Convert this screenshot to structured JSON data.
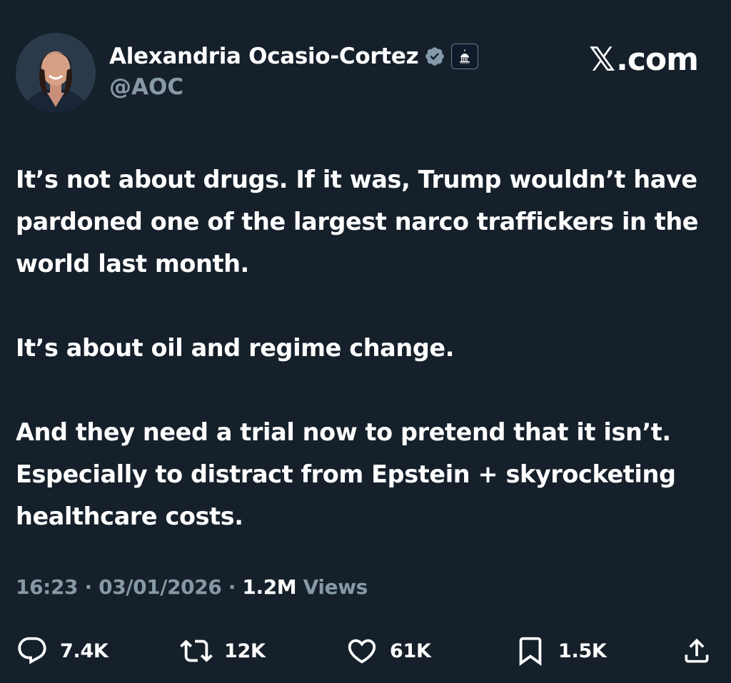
{
  "author": {
    "display_name": "Alexandria Ocasio-Cortez",
    "handle": "@AOC"
  },
  "source": {
    "logo_letter": "𝕏",
    "logo_domain": ".com"
  },
  "tweet": {
    "paragraphs": [
      "It’s not about drugs. If it was, Trump wouldn’t have pardoned one of the largest narco traffickers in the world last month.",
      "It’s about oil and regime change.",
      "And they need a trial now to pretend that it isn’t. Especially to distract from Epstein + skyrocketing healthcare costs."
    ]
  },
  "meta": {
    "time": "16:23",
    "separator": "·",
    "date": "03/01/2026",
    "views_count": "1.2M",
    "views_label": "Views"
  },
  "actions": {
    "replies": "7.4K",
    "reposts": "12K",
    "likes": "61K",
    "bookmarks": "1.5K"
  },
  "colors": {
    "background": "#15202b",
    "text": "#ffffff",
    "muted": "#8899a6",
    "verified_badge": "#829aab"
  },
  "icons": [
    "verified-badge-icon",
    "capitol-affiliation-icon",
    "reply-icon",
    "repost-icon",
    "like-icon",
    "bookmark-icon",
    "share-icon"
  ]
}
